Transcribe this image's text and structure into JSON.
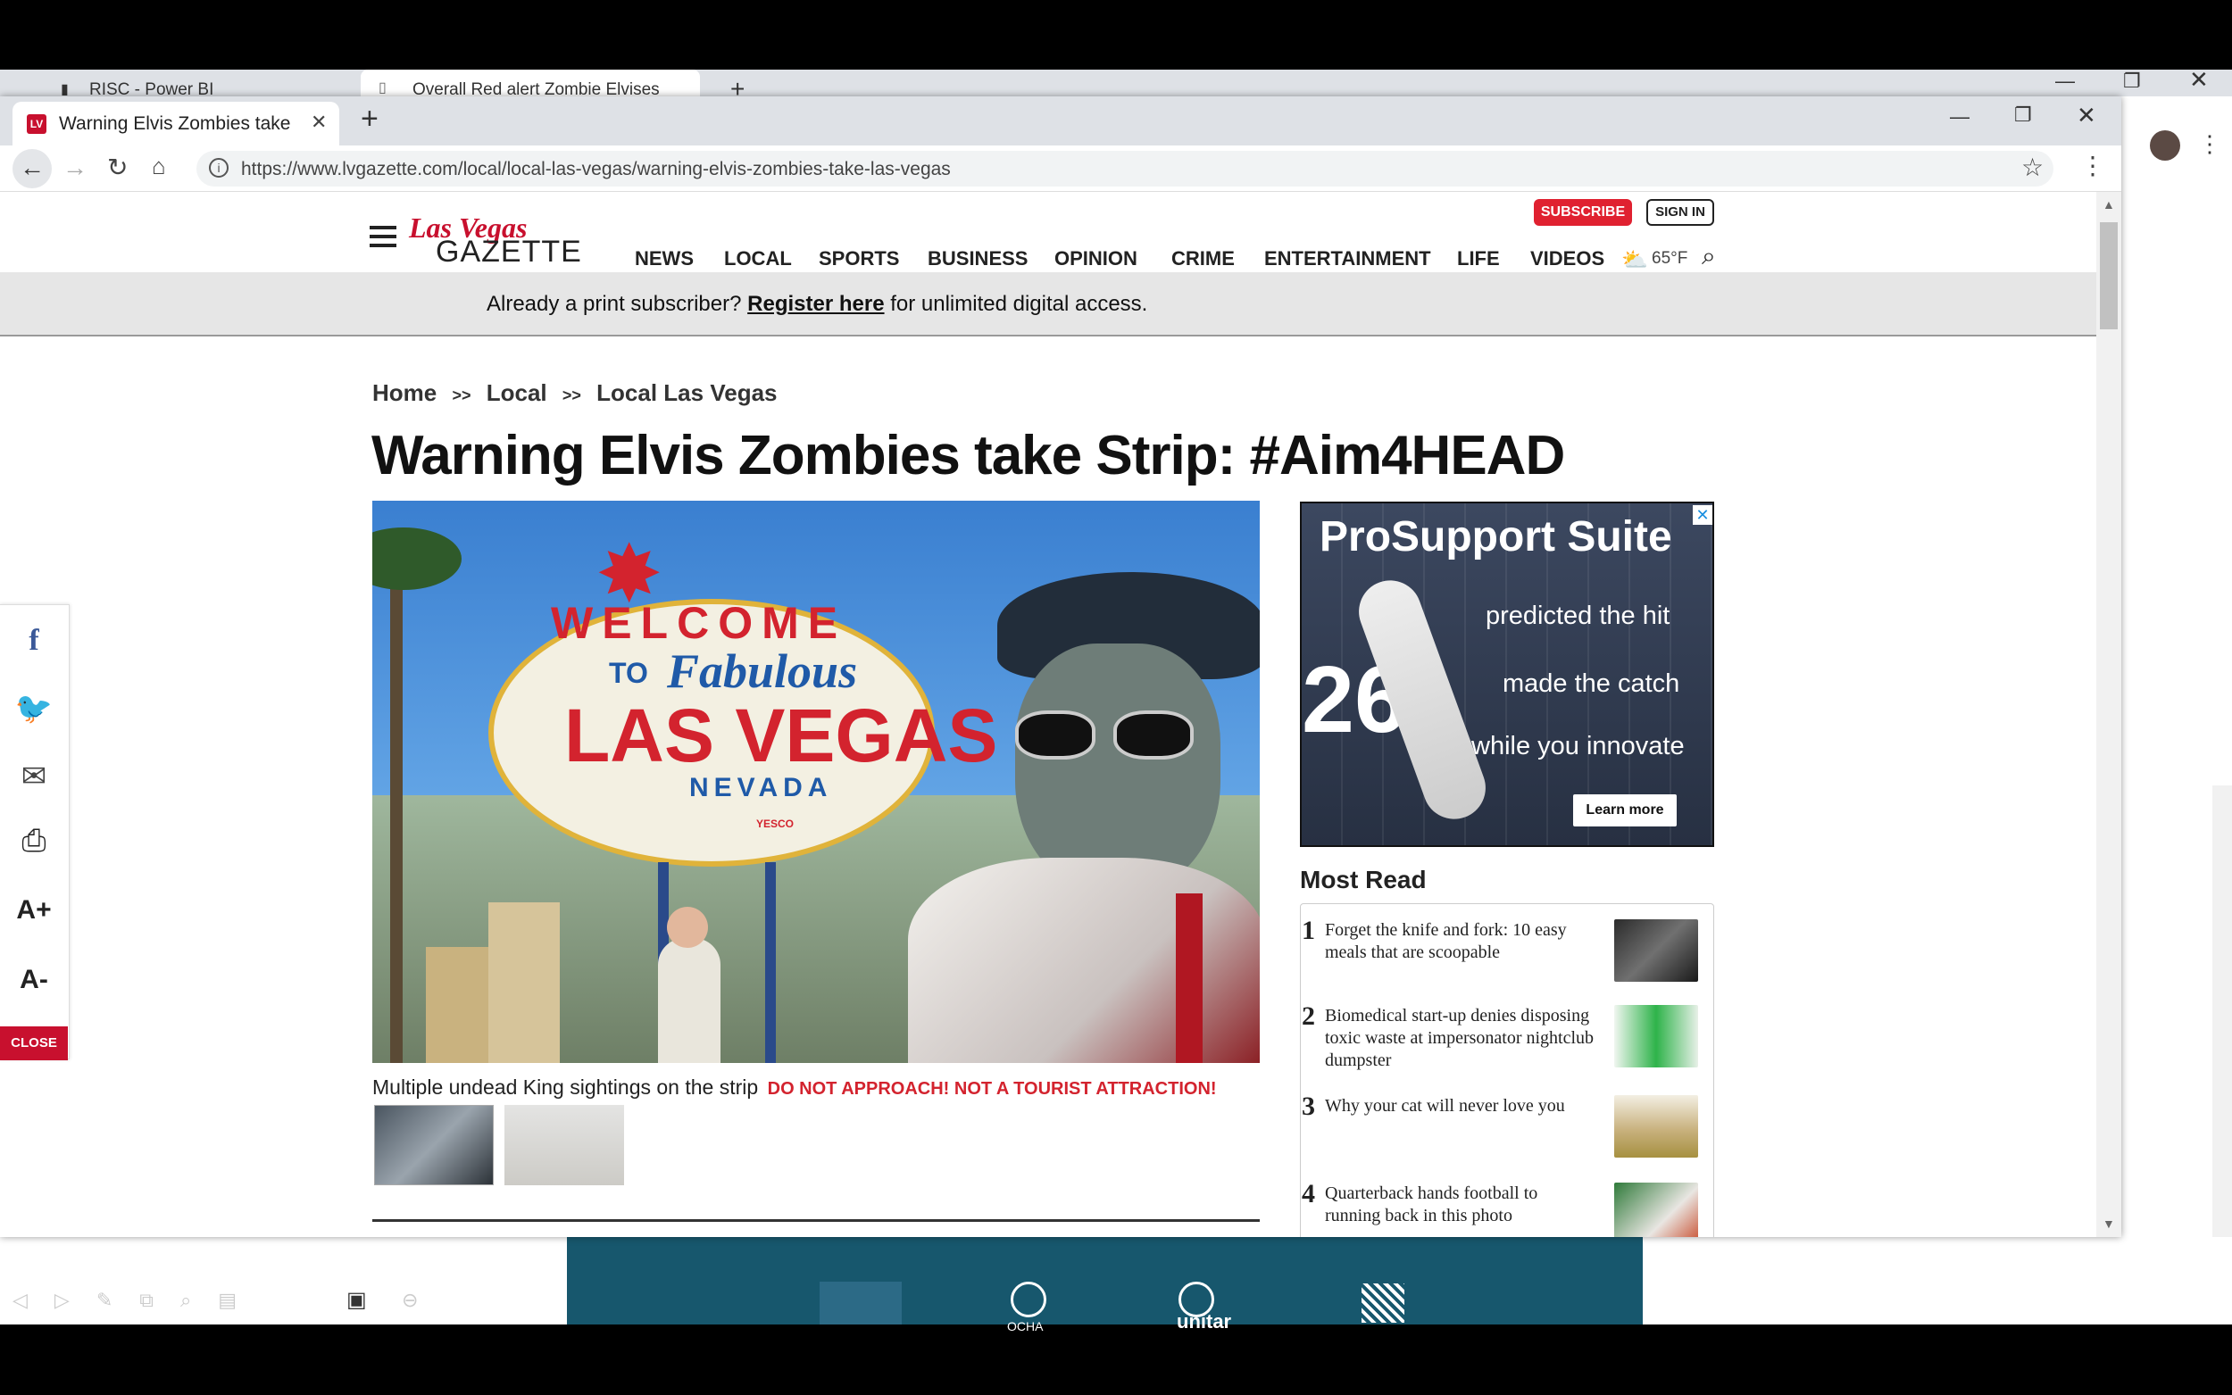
{
  "back_window": {
    "tabs": [
      {
        "label": "RISC - Power BI"
      },
      {
        "label": "Overall Red alert Zombie Elvises"
      }
    ],
    "new_tab_symbol": "+"
  },
  "browser": {
    "tab_title": "Warning Elvis Zombies take",
    "url": "https://www.lvgazette.com/local/local-las-vegas/warning-elvis-zombies-take-las-vegas",
    "new_tab_symbol": "+"
  },
  "site": {
    "logo_script": "Las Vegas",
    "logo_text": "GAZETTE",
    "subscribe_label": "SUBSCRIBE",
    "signin_label": "SIGN IN",
    "nav": [
      "NEWS",
      "LOCAL",
      "SPORTS",
      "BUSINESS",
      "OPINION",
      "CRIME",
      "ENTERTAINMENT",
      "LIFE",
      "VIDEOS"
    ],
    "weather": "65°F",
    "banner_prefix": "Already a print subscriber?",
    "banner_link": "Register here",
    "banner_suffix": "for unlimited digital access."
  },
  "breadcrumb": {
    "items": [
      "Home",
      "Local",
      "Local Las Vegas"
    ],
    "separator": ">>"
  },
  "article": {
    "headline": "Warning Elvis Zombies take Strip: #Aim4HEAD",
    "caption": "Multiple undead King sightings on the strip",
    "caption_alert": "DO NOT APPROACH! NOT A TOURIST ATTRACTION!",
    "image_text": {
      "welcome": "WELCOME",
      "to": "TO",
      "fabulous": "Fabulous",
      "city": "LAS VEGAS",
      "state": "NEVADA",
      "brand": "YESCO"
    }
  },
  "ad": {
    "title": "ProSupport Suite",
    "line1": "predicted the hit",
    "line2": "made the catch",
    "line3": "while you innovate",
    "number": "26",
    "cta": "Learn more"
  },
  "most_read": {
    "title": "Most Read",
    "items": [
      {
        "num": "1",
        "text": "Forget the knife and fork: 10 easy meals that are scoopable"
      },
      {
        "num": "2",
        "text": "Biomedical start-up denies disposing toxic waste at impersonator nightclub dumpster"
      },
      {
        "num": "3",
        "text": "Why your cat will never love you"
      },
      {
        "num": "4",
        "text": "Quarterback hands football to running back in this photo"
      }
    ]
  },
  "share_bar": {
    "font_up": "A+",
    "font_down": "A-",
    "close_label": "CLOSE"
  },
  "footer_logos": [
    "OCHA",
    "unitar"
  ]
}
